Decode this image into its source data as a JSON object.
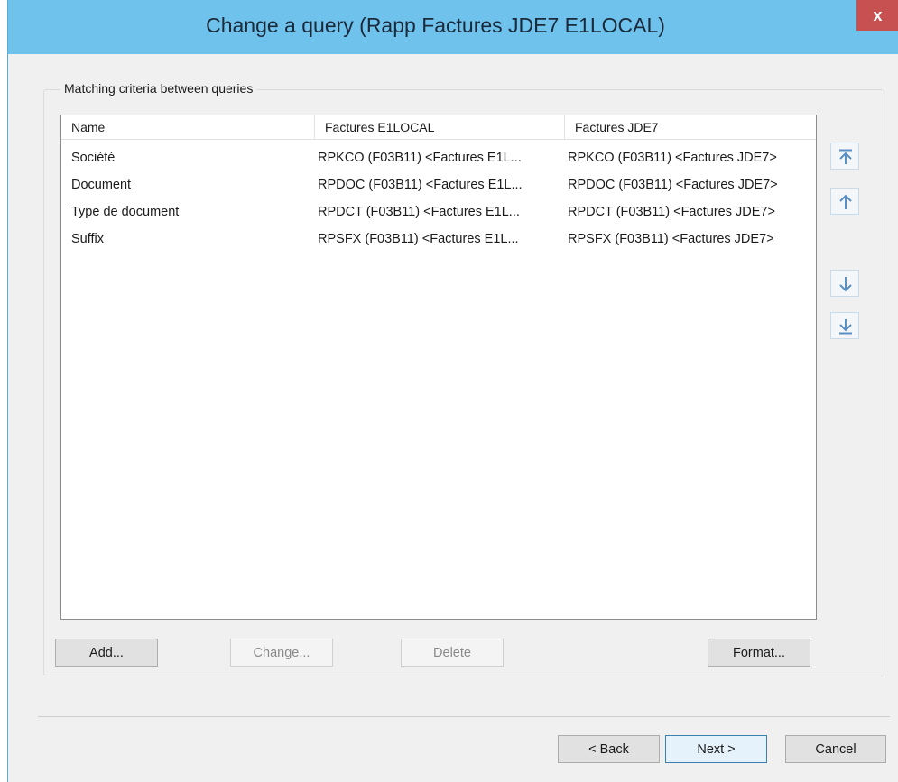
{
  "window": {
    "title": "Change a query (Rapp Factures JDE7 E1LOCAL)",
    "close_label": "x"
  },
  "group": {
    "legend": "Matching criteria between queries"
  },
  "table": {
    "columns": [
      "Name",
      "Factures E1LOCAL",
      "Factures JDE7"
    ],
    "rows": [
      [
        "Société",
        "RPKCO (F03B11) <Factures E1L...",
        "RPKCO (F03B11) <Factures JDE7>"
      ],
      [
        "Document",
        "RPDOC (F03B11) <Factures E1L...",
        "RPDOC (F03B11) <Factures JDE7>"
      ],
      [
        "Type de document",
        "RPDCT (F03B11) <Factures E1L...",
        "RPDCT (F03B11) <Factures JDE7>"
      ],
      [
        "Suffix",
        "RPSFX (F03B11) <Factures E1L...",
        "RPSFX (F03B11) <Factures JDE7>"
      ]
    ]
  },
  "side_buttons": {
    "move_top_icon": "move-to-top-icon",
    "move_up_icon": "move-up-icon",
    "move_down_icon": "move-down-icon",
    "move_bottom_icon": "move-to-bottom-icon",
    "icon_color": "#5a8fc4"
  },
  "actions": {
    "add": "Add...",
    "change": "Change...",
    "delete": "Delete",
    "format": "Format..."
  },
  "footer": {
    "back": "< Back",
    "next": "Next >",
    "cancel": "Cancel"
  },
  "colors": {
    "titlebar": "#6fc2ec",
    "close": "#c75050",
    "accent": "#3c7fb1"
  }
}
